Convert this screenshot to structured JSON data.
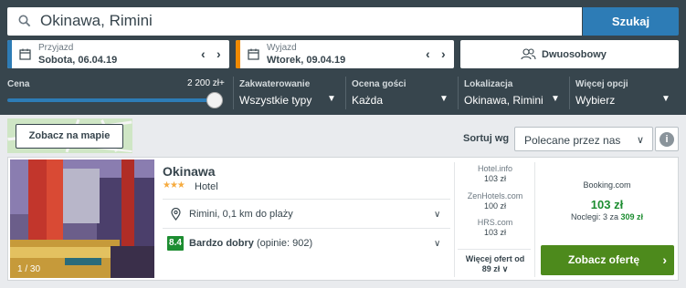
{
  "search": {
    "value": "Okinawa, Rimini",
    "button": "Szukaj"
  },
  "checkin": {
    "label": "Przyjazd",
    "value": "Sobota, 06.04.19",
    "accent": "#2d7cb6"
  },
  "checkout": {
    "label": "Wyjazd",
    "value": "Wtorek, 09.04.19",
    "accent": "#f18a00"
  },
  "room": {
    "value": "Dwuosobowy",
    "icon": "guests-icon"
  },
  "filters": {
    "price": {
      "label": "Cena",
      "max": "2 200 zł+",
      "level": 1.0
    },
    "accommodation": {
      "label": "Zakwaterowanie",
      "value": "Wszystkie typy"
    },
    "guest_rating": {
      "label": "Ocena gości",
      "value": "Każda"
    },
    "location": {
      "label": "Lokalizacja",
      "value": "Okinawa, Rimini"
    },
    "more": {
      "label": "Więcej opcji",
      "value": "Wybierz"
    }
  },
  "map": {
    "button": "Zobacz na mapie"
  },
  "sort": {
    "label": "Sortuj wg",
    "value": "Polecane przez nas",
    "info": "i"
  },
  "hotel": {
    "name": "Okinawa",
    "stars": "★★★",
    "star_count": 3,
    "type": "Hotel",
    "photo_counter": "1 / 30",
    "location": "Rimini, 0,1 km do plaży",
    "rating_score": "8.4",
    "rating_label": "Bardzo dobry",
    "rating_reviews": "(opinie: 902)",
    "rating_color": "#1d8d31",
    "offers": [
      {
        "site": "Hotel.info",
        "price": "103 zł"
      },
      {
        "site": "ZenHotels.com",
        "price": "100 zł"
      },
      {
        "site": "HRS.com",
        "price": "103 zł"
      }
    ],
    "more_offers_label": "Więcej ofert od",
    "more_offers_price": "89 zł",
    "best": {
      "site": "Booking.com",
      "price": "103 zł",
      "nights_prefix": "Noclegi: 3 za",
      "nights_total": "309 zł",
      "button": "Zobacz ofertę"
    }
  }
}
